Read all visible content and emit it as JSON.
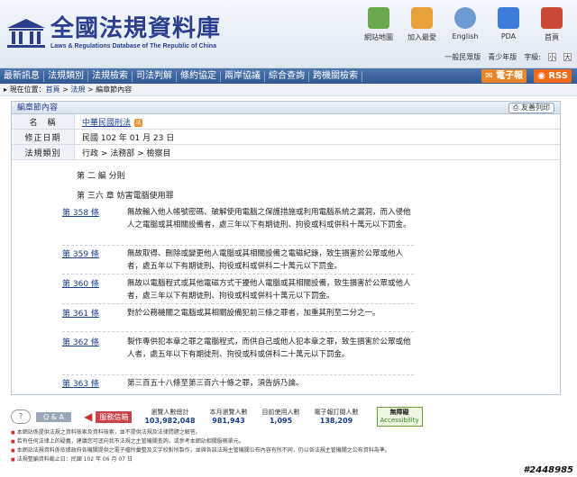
{
  "site": {
    "title": "全國法規資料庫",
    "subtitle": "Laws & Regulations Database of The Republic of China"
  },
  "topicons": [
    {
      "label": "網站地圖",
      "icon": "sitemap-icon",
      "color": "#6aa84f"
    },
    {
      "label": "加入最愛",
      "icon": "favorite-icon",
      "color": "#e9a13b"
    },
    {
      "label": "English",
      "icon": "english-icon",
      "color": "#6b9bd1"
    },
    {
      "label": "PDA",
      "icon": "pda-icon",
      "color": "#3b7dd8"
    },
    {
      "label": "首頁",
      "icon": "home-icon",
      "color": "#c94a3a"
    }
  ],
  "sublinks": {
    "general": "一般民眾版",
    "youth": "青少年版",
    "fontsize": "字級:",
    "size_labels": [
      "小",
      "大"
    ]
  },
  "nav": {
    "items": [
      "最新訊息",
      "法規類別",
      "法規檢索",
      "司法判解",
      "條約協定",
      "兩岸協議",
      "綜合查詢",
      "跨機關檢索"
    ],
    "epaper": "電子報",
    "rss": "RSS"
  },
  "breadcrumb": {
    "prefix": "現在位置：",
    "items": [
      "首頁",
      "法規",
      "編章節內容"
    ],
    "sep": " > "
  },
  "panel": {
    "title": "編章節內容",
    "print": "友善列印",
    "rows": [
      {
        "label": "名　稱",
        "value": "中華民國刑法",
        "link": true
      },
      {
        "label": "修正日期",
        "value": "民國 102 年 01 月 23 日",
        "link": false
      },
      {
        "label": "法規類別",
        "value": "行政 > 法務部 > 檢察目",
        "link": false
      }
    ],
    "part": "第 二 編 分則",
    "chapter": "第 三六 章 妨害電腦使用罪",
    "articles": [
      {
        "no": "第 358 條",
        "text": "無故輸入他人帳號密碼、破解使用電腦之保護措施或利用電腦系統之漏洞，而入侵他人之電腦或其相關設備者，處三年以下有期徒刑、拘役或科或併科十萬元以下罰金。"
      },
      {
        "no": "第 359 條",
        "text": "無故取得、刪除或變更他人電腦或其相關設備之電磁紀錄，致生損害於公眾或他人者，處五年以下有期徒刑、拘役或科或併科二十萬元以下罰金。"
      },
      {
        "no": "第 360 條",
        "text": "無故以電腦程式或其他電磁方式干擾他人電腦或其相關設備，致生損害於公眾或他人者，處三年以下有期徒刑、拘役或科或併科十萬元以下罰金。"
      },
      {
        "no": "第 361 條",
        "text": "對於公務機關之電腦或其相關設備犯前三條之罪者，加重其刑至二分之一。"
      },
      {
        "no": "第 362 條",
        "text": "製作專供犯本章之罪之電腦程式，而供自己或他人犯本章之罪，致生損害於公眾或他人者，處五年以下有期徒刑、拘役或科或併科二十萬元以下罰金。"
      },
      {
        "no": "第 363 條",
        "text": "第三百五十八條至第三百六十條之罪，須告訴乃論。"
      }
    ]
  },
  "footer": {
    "qa": "Q & A",
    "service": "服務信箱",
    "stats": [
      {
        "label": "瀏覽人數總計",
        "value": "103,982,048"
      },
      {
        "label": "本月瀏覽人數",
        "value": "981,943"
      },
      {
        "label": "目前使用人數",
        "value": "1,095"
      },
      {
        "label": "電子報訂閱人數",
        "value": "138,209"
      }
    ],
    "badge_line1": "無障礙",
    "badge_line2": "Accessibility",
    "notes": [
      "本網站係提供法規之資料檢索及資料檢索，並不提供法規及法律問題之解答。",
      "若有任何法律上的疑義，建議您可逕向我市法規之主管機關查詢，或參考本網站相關服務單元。",
      "本網站法規資料係依據政府各機關提供之電子檔所彙整及文字校對所製作，並與各該法規主管機關公布內容有所不同，仍以各法規主管機關之公布資料為準。",
      "法規整編資料截止日：民國 102 年 06 月 07 日"
    ]
  },
  "watermark": "#2448985",
  "colors": {
    "brand": "#2c3f8f",
    "nav": "#2f5892",
    "epaper": "#e9862b",
    "rss": "#f06a1a"
  }
}
